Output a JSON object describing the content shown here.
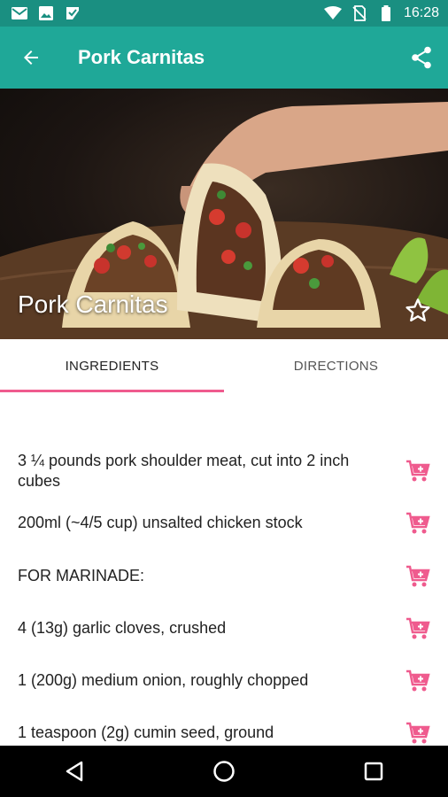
{
  "status_bar": {
    "time": "16:28",
    "left_icons": [
      "mail-icon",
      "image-icon",
      "check-bag-icon"
    ],
    "right_icons": [
      "wifi-icon",
      "no-sim-icon",
      "battery-icon"
    ]
  },
  "app_bar": {
    "title": "Pork Carnitas",
    "back_icon": "arrow-left-icon",
    "share_icon": "share-icon",
    "color": "#1fa898"
  },
  "hero": {
    "title": "Pork Carnitas",
    "favorite_icon": "star-outline-icon"
  },
  "tabs": [
    {
      "label": "INGREDIENTS",
      "active": true
    },
    {
      "label": "DIRECTIONS",
      "active": false
    }
  ],
  "accent_color": "#ef5b8e",
  "ingredients": [
    "3 ¼ pounds pork shoulder meat, cut into 2 inch cubes",
    "200ml (~4/5 cup) unsalted chicken stock",
    "FOR MARINADE:",
    "4 (13g) garlic cloves, crushed",
    "1 (200g) medium onion, roughly chopped",
    "1 teaspoon (2g) cumin seed, ground"
  ],
  "nav_bar": {
    "icons": [
      "back-triangle-icon",
      "home-circle-icon",
      "recents-square-icon"
    ]
  }
}
